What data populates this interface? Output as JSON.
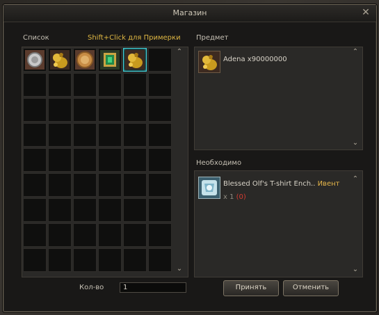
{
  "window": {
    "title": "Магазин"
  },
  "list": {
    "label": "Список",
    "hint": "Shift+Click для Примерки",
    "items": [
      {
        "icon": "silver-coin-icon"
      },
      {
        "icon": "adena-bag-icon"
      },
      {
        "icon": "gold-coin-icon"
      },
      {
        "icon": "green-book-icon"
      },
      {
        "icon": "adena-bag-icon",
        "selected": true
      }
    ]
  },
  "item_panel": {
    "label": "Предмет",
    "name": "Adena x90000000"
  },
  "required_panel": {
    "label": "Необходимо",
    "name": "Blessed Olf's T-shirt Ench..",
    "tag": "Ивент",
    "qty_prefix": "x 1",
    "qty_owned": "(0)"
  },
  "quantity": {
    "label": "Кол-во",
    "value": "1"
  },
  "buttons": {
    "accept": "Принять",
    "cancel": "Отменить"
  },
  "colors": {
    "hint": "#e0b843",
    "event": "#e6b64a",
    "owned_zero": "#d43b31",
    "selected_cell": "#3fd0d8"
  }
}
